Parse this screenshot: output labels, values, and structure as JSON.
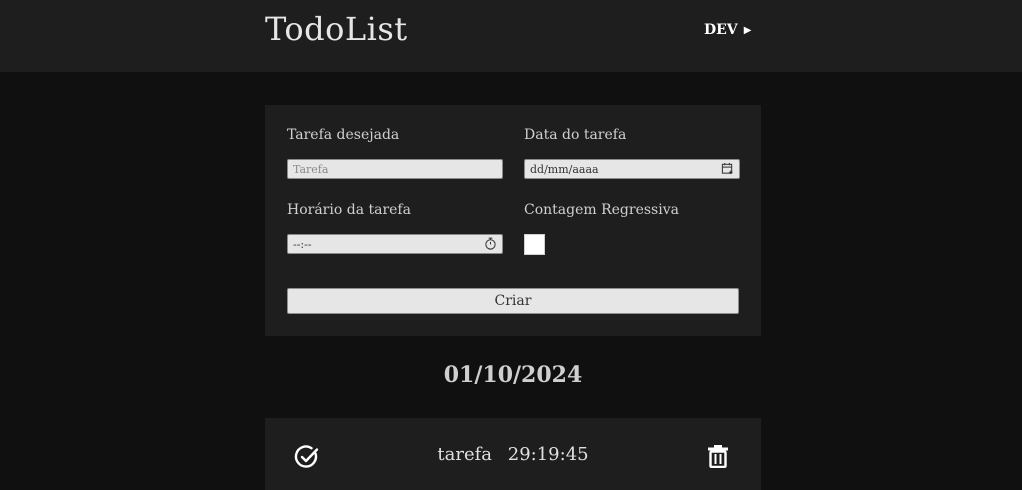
{
  "header": {
    "title": "TodoList",
    "dev_label": "DEV",
    "dev_arrow": "▶"
  },
  "form": {
    "task_label": "Tarefa desejada",
    "task_placeholder": "Tarefa",
    "date_label": "Data do tarefa",
    "date_placeholder": "dd/mm/aaaa",
    "time_label": "Horário da tarefa",
    "time_placeholder": "--:--",
    "countdown_label": "Contagem Regressiva",
    "countdown_checked": false,
    "submit_label": "Criar"
  },
  "tasks_group": {
    "date": "01/10/2024",
    "items": [
      {
        "name": "tarefa",
        "countdown": "29:19:45"
      }
    ]
  },
  "icons": {
    "date_field": "calendar-icon",
    "time_field": "stopwatch-icon",
    "complete": "check-circle-icon",
    "delete": "trash-icon"
  },
  "colors": {
    "page_bg": "#101010",
    "card_bg": "#1e1e1e",
    "text": "#d9d9d9",
    "input_bg": "#e6e6e6"
  }
}
